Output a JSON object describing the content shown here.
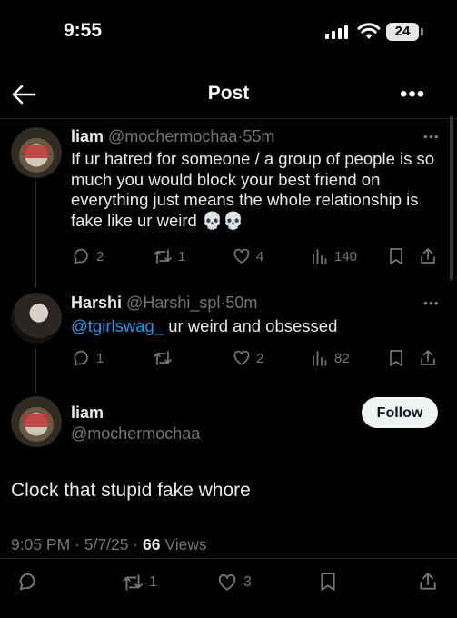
{
  "status_bar": {
    "time": "9:55",
    "battery": "24"
  },
  "header": {
    "title": "Post"
  },
  "replies": [
    {
      "name": "liam",
      "handle": "@mochermochaa",
      "sep": "·",
      "time": "55m",
      "text": "If ur hatred for someone / a group of people is so much you would block your best friend on everything just means the whole relationship is fake like ur weird 💀💀",
      "stats": {
        "replies": "2",
        "reposts": "1",
        "likes": "4",
        "views": "140"
      }
    },
    {
      "name": "Harshi",
      "handle": "@Harshi_spl",
      "sep": "·",
      "time": "50m",
      "mention": "@tgirlswag_",
      "text": " ur weird and obsessed",
      "stats": {
        "replies": "1",
        "reposts": "",
        "likes": "2",
        "views": "82"
      }
    }
  ],
  "main_post": {
    "name": "liam",
    "handle": "@mochermochaa",
    "follow_label": "Follow",
    "text": "Clock that stupid fake whore",
    "time": "9:05 PM",
    "date": "5/7/25",
    "views_count": "66",
    "views_label": "Views",
    "sep": "·",
    "stats": {
      "reposts": "1",
      "likes": "3"
    }
  },
  "colors": {
    "accent": "#1d9bf0",
    "muted": "#71767b",
    "background": "#000000"
  }
}
